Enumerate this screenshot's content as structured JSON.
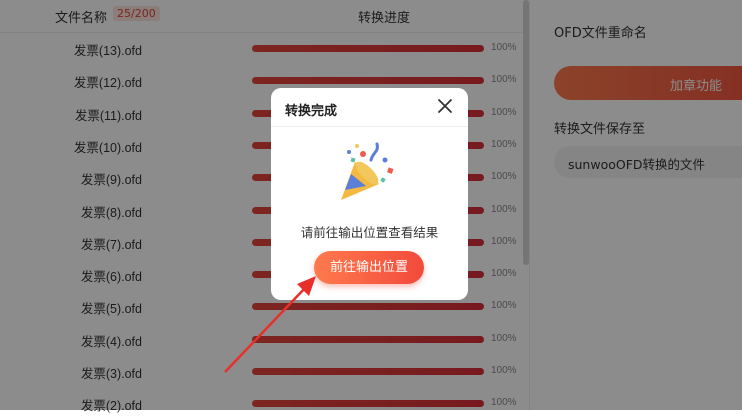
{
  "table": {
    "header_name": "文件名称",
    "header_count": "25/200",
    "header_progress": "转换进度",
    "rows": [
      {
        "name": "发票(13).ofd",
        "progress": 1.0,
        "pct": "100%"
      },
      {
        "name": "发票(12).ofd",
        "progress": 1.0,
        "pct": "100%"
      },
      {
        "name": "发票(11).ofd",
        "progress": 1.0,
        "pct": "100%"
      },
      {
        "name": "发票(10).ofd",
        "progress": 1.0,
        "pct": "100%"
      },
      {
        "name": "发票(9).ofd",
        "progress": 1.0,
        "pct": "100%"
      },
      {
        "name": "发票(8).ofd",
        "progress": 1.0,
        "pct": "100%"
      },
      {
        "name": "发票(7).ofd",
        "progress": 1.0,
        "pct": "100%"
      },
      {
        "name": "发票(6).ofd",
        "progress": 1.0,
        "pct": "100%"
      },
      {
        "name": "发票(5).ofd",
        "progress": 1.0,
        "pct": "100%"
      },
      {
        "name": "发票(4).ofd",
        "progress": 1.0,
        "pct": "100%"
      },
      {
        "name": "发票(3).ofd",
        "progress": 1.0,
        "pct": "100%"
      },
      {
        "name": "发票(2).ofd",
        "progress": 1.0,
        "pct": "100%"
      }
    ]
  },
  "right_panel": {
    "rename_label": "OFD文件重命名",
    "stamp_button": "加章功能",
    "save_label": "转换文件保存至",
    "save_path": "sunwooOFD转换的文件"
  },
  "modal": {
    "title": "转换完成",
    "message": "请前往输出位置查看结果",
    "button": "前往输出位置",
    "icons": [
      "close-icon",
      "party-popper-icon"
    ]
  },
  "colors": {
    "accent": "#f0513f",
    "progress": "#e3453b",
    "annotation_arrow": "#e8302a"
  }
}
